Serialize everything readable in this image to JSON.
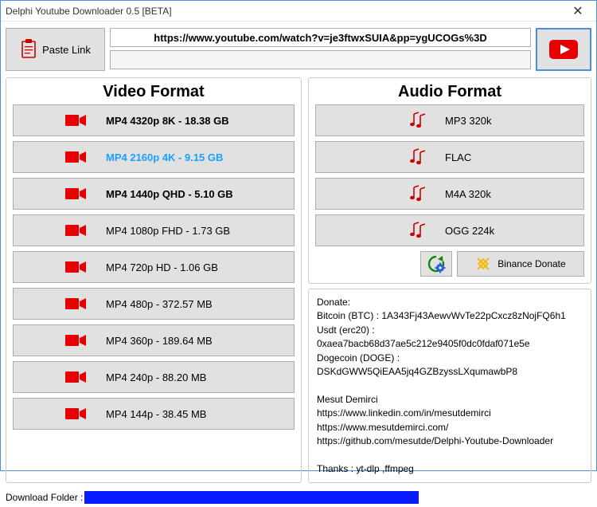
{
  "window_title": "Delphi Youtube Downloader 0.5 [BETA]",
  "paste_label": "Paste Link",
  "url": "https://www.youtube.com/watch?v=je3ftwxSUIA&pp=ygUCOGs%3D",
  "video_heading": "Video Format",
  "audio_heading": "Audio Format",
  "video_formats": [
    {
      "label": "MP4 4320p 8K - 18.38 GB",
      "bold": true
    },
    {
      "label": "MP4 2160p 4K - 9.15 GB",
      "bold": true,
      "selected": true
    },
    {
      "label": "MP4 1440p QHD - 5.10 GB",
      "bold": true
    },
    {
      "label": "MP4 1080p FHD - 1.73 GB"
    },
    {
      "label": "MP4 720p HD - 1.06 GB"
    },
    {
      "label": "MP4 480p - 372.57 MB"
    },
    {
      "label": "MP4 360p - 189.64 MB"
    },
    {
      "label": "MP4 240p - 88.20 MB"
    },
    {
      "label": "MP4 144p - 38.45 MB"
    }
  ],
  "audio_formats": [
    {
      "label": "MP3 320k"
    },
    {
      "label": "FLAC"
    },
    {
      "label": "M4A 320k"
    },
    {
      "label": "OGG 224k"
    }
  ],
  "binance_donate_label": "Binance Donate",
  "info_text": "Donate:\nBitcoin (BTC)  : 1A343Fj43AewvWvTe22pCxcz8zNojFQ6h1\nUsdt (erc20)    : 0xaea7bacb68d37ae5c212e9405f0dc0fdaf071e5e\nDogecoin (DOGE)  : DSKdGWW5QiEAA5jq4GZBzyssLXqumawbP8\n\nMesut Demirci\nhttps://www.linkedin.com/in/mesutdemirci\nhttps://www.mesutdemirci.com/\nhttps://github.com/mesutde/Delphi-Youtube-Downloader\n\nThanks : yt-dlp ,ffmpeg",
  "footer_label": "Download Folder :"
}
